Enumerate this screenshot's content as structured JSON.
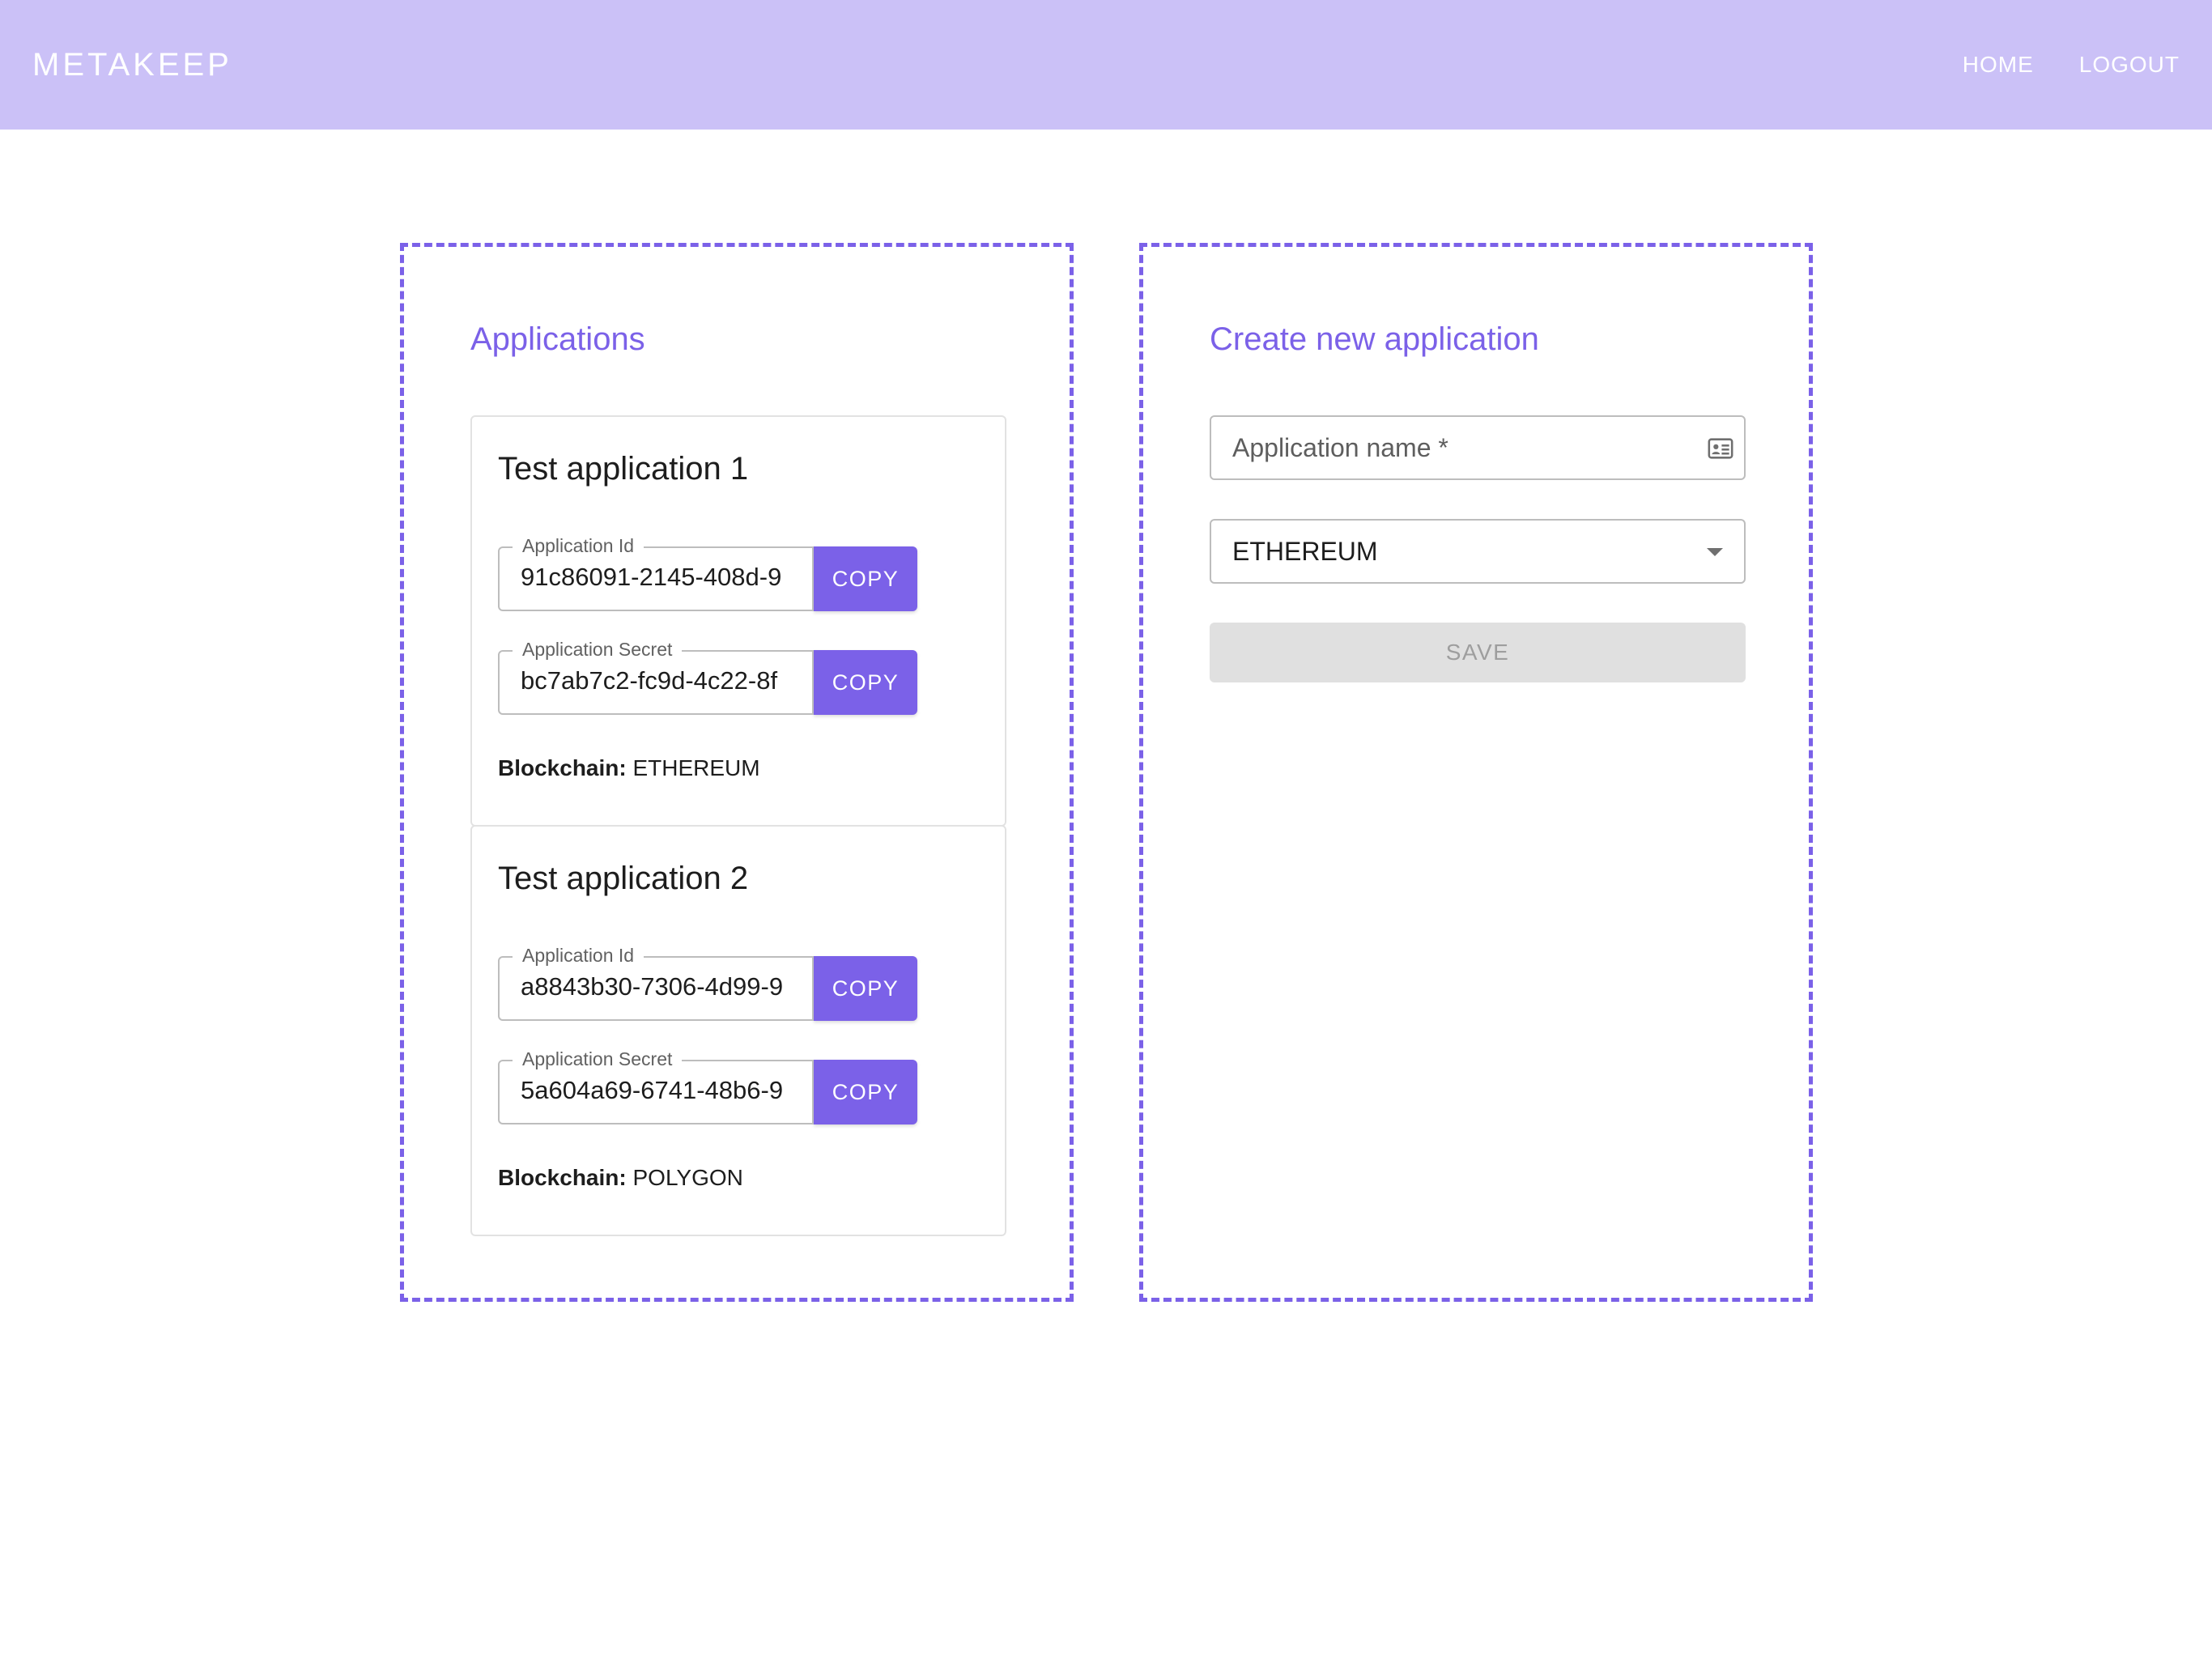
{
  "header": {
    "brand": "METAKEEP",
    "nav": [
      "HOME",
      "LOGOUT"
    ]
  },
  "applications_panel": {
    "title": "Applications",
    "apps": [
      {
        "name": "Test application 1",
        "id_label": "Application Id",
        "id_value": "91c86091-2145-408d-9",
        "secret_label": "Application Secret",
        "secret_value": "bc7ab7c2-fc9d-4c22-8f",
        "copy_label": "COPY",
        "blockchain_label": "Blockchain:",
        "blockchain_value": "ETHEREUM"
      },
      {
        "name": "Test application 2",
        "id_label": "Application Id",
        "id_value": "a8843b30-7306-4d99-9",
        "secret_label": "Application Secret",
        "secret_value": "5a604a69-6741-48b6-9",
        "copy_label": "COPY",
        "blockchain_label": "Blockchain:",
        "blockchain_value": "POLYGON"
      }
    ]
  },
  "create_panel": {
    "title": "Create new application",
    "name_placeholder": "Application name *",
    "name_icon": "contact-card-icon",
    "blockchain_selected": "ETHEREUM",
    "save_label": "SAVE"
  },
  "colors": {
    "accent": "#7b61e8",
    "topbar": "#cbc1f7",
    "disabled_bg": "#e0e0e0"
  }
}
